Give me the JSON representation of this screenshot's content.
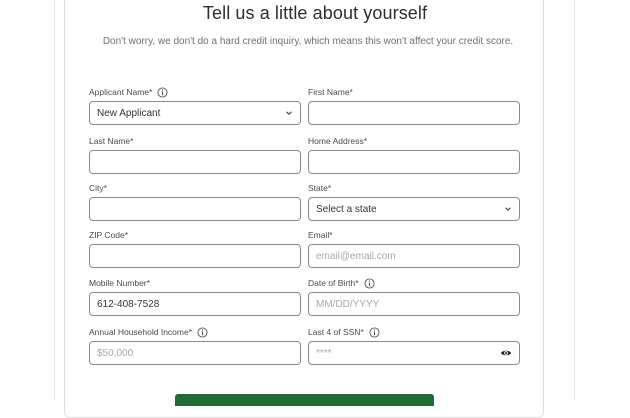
{
  "title": "Tell us a little about yourself",
  "subtitle": "Don't worry, we don't do a hard credit inquiry, which means this won't affect your credit score.",
  "fields": {
    "applicant_name": {
      "label": "Applicant Name*",
      "value": "New Applicant",
      "icon": "chevron-down-icon",
      "info_icon": "info-icon"
    },
    "first_name": {
      "label": "First Name*",
      "value": ""
    },
    "last_name": {
      "label": "Last Name*",
      "value": ""
    },
    "home_address": {
      "label": "Home Address*",
      "value": ""
    },
    "city": {
      "label": "City*",
      "value": ""
    },
    "state": {
      "label": "State*",
      "value": "Select a state",
      "icon": "chevron-down-icon"
    },
    "zip_code": {
      "label": "ZIP Code*",
      "value": ""
    },
    "email": {
      "label": "Email*",
      "placeholder": "email@email.com"
    },
    "mobile_number": {
      "label": "Mobile Number*",
      "value": "612-408-7528"
    },
    "date_of_birth": {
      "label": "Date of Birth*",
      "placeholder": "MM/DD/YYYY",
      "info_icon": "info-icon"
    },
    "annual_household_income": {
      "label": "Annual Household Income*",
      "placeholder": "$50,000",
      "info_icon": "info-icon"
    },
    "last4_ssn": {
      "label": "Last 4 of SSN*",
      "placeholder": "****",
      "info_icon": "info-icon",
      "icon": "eye-icon"
    }
  },
  "colors": {
    "primary_button": "#1f6b35",
    "border": "#8b8b8b",
    "placeholder": "#a8a8a8"
  }
}
